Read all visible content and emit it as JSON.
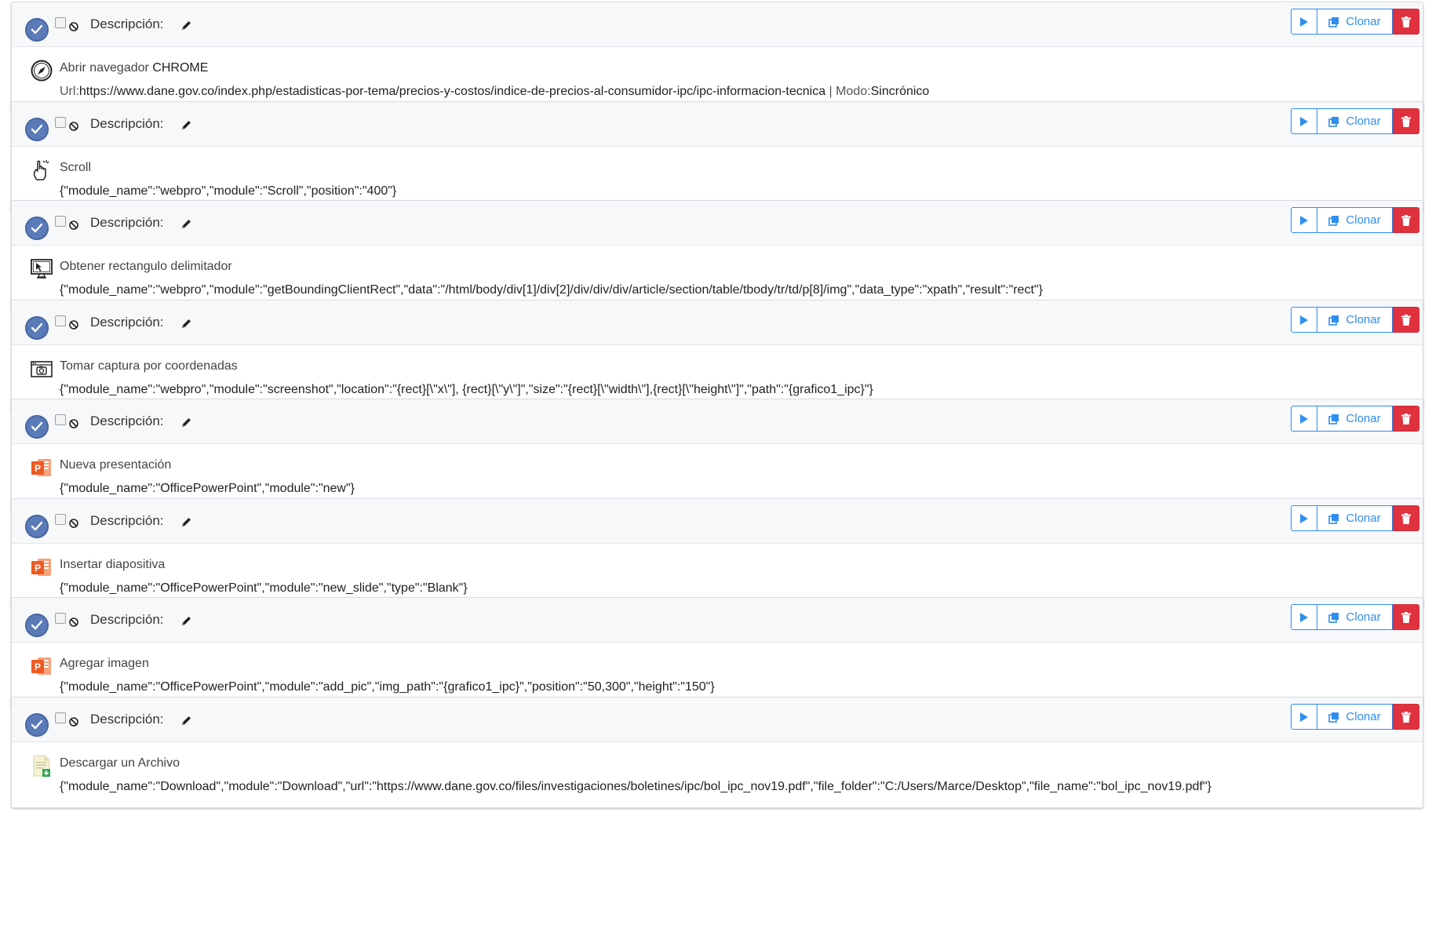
{
  "desc_label": "Descripción:",
  "clone_label": "Clonar",
  "steps": [
    {
      "icon": "compass-icon",
      "title": "Abrir navegador ",
      "title_strong": "CHROME",
      "url_label": "Url:",
      "url_value": "https://www.dane.gov.co/index.php/estadisticas-por-tema/precios-y-costos/indice-de-precios-al-consumidor-ipc/ipc-informacion-tecnica",
      "sep": " | ",
      "mode_label": "Modo:",
      "mode_value": "Sincrónico"
    },
    {
      "icon": "hand-pointer-icon",
      "title": "Scroll",
      "detail": "{\"module_name\":\"webpro\",\"module\":\"Scroll\",\"position\":\"400\"}"
    },
    {
      "icon": "monitor-cursor-icon",
      "title": "Obtener rectangulo delimitador",
      "detail": "{\"module_name\":\"webpro\",\"module\":\"getBoundingClientRect\",\"data\":\"/html/body/div[1]/div[2]/div/div/div/article/section/table/tbody/tr/td/p[8]/img\",\"data_type\":\"xpath\",\"result\":\"rect\"}"
    },
    {
      "icon": "camera-screenshot-icon",
      "title": "Tomar captura por coordenadas",
      "detail": "{\"module_name\":\"webpro\",\"module\":\"screenshot\",\"location\":\"{rect}[\\\"x\\\"], {rect}[\\\"y\\\"]\",\"size\":\"{rect}[\\\"width\\\"],{rect}[\\\"height\\\"]\",\"path\":\"{grafico1_ipc}\"}"
    },
    {
      "icon": "powerpoint-icon",
      "title": "Nueva presentación",
      "detail": "{\"module_name\":\"OfficePowerPoint\",\"module\":\"new\"}"
    },
    {
      "icon": "powerpoint-icon",
      "title": "Insertar diapositiva",
      "detail": "{\"module_name\":\"OfficePowerPoint\",\"module\":\"new_slide\",\"type\":\"Blank\"}"
    },
    {
      "icon": "powerpoint-icon",
      "title": "Agregar imagen",
      "detail": "{\"module_name\":\"OfficePowerPoint\",\"module\":\"add_pic\",\"img_path\":\"{grafico1_ipc}\",\"position\":\"50,300\",\"height\":\"150\"}"
    },
    {
      "icon": "file-download-icon",
      "title": "Descargar un Archivo",
      "detail": "{\"module_name\":\"Download\",\"module\":\"Download\",\"url\":\"https://www.dane.gov.co/files/investigaciones/boletines/ipc/bol_ipc_nov19.pdf\",\"file_folder\":\"C:/Users/Marce/Desktop\",\"file_name\":\"bol_ipc_nov19.pdf\"}"
    }
  ],
  "colors": {
    "primary": "#2f8ef0",
    "danger": "#e0313f",
    "check": "#5a7ab8",
    "powerpoint": "#ee5a24"
  }
}
